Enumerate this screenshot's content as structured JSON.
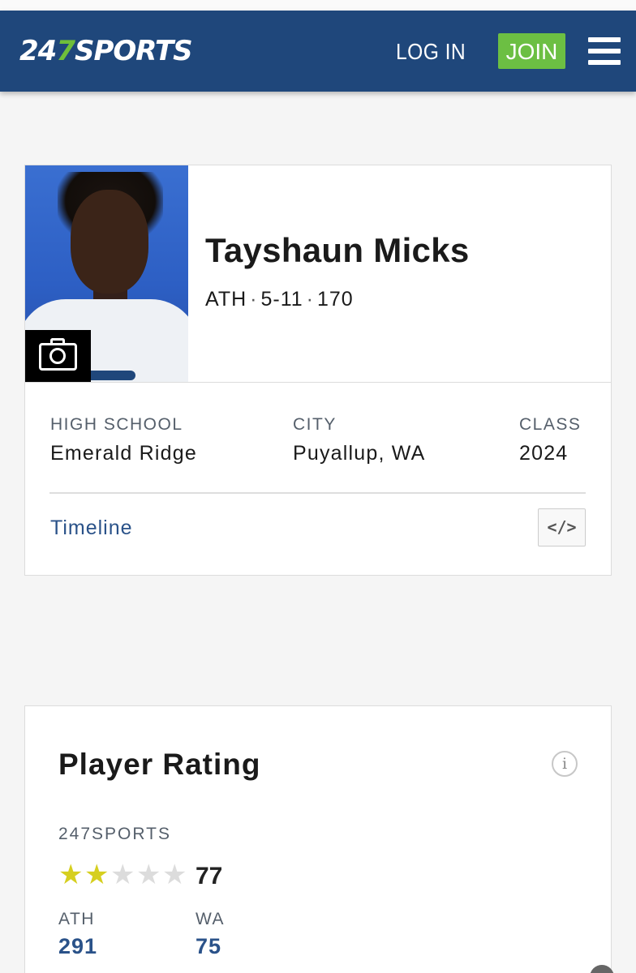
{
  "header": {
    "logo_prefix": "24",
    "logo_seven": "7",
    "logo_suffix": "SPORTS",
    "login_label": "LOG IN",
    "join_label": "JOIN",
    "menu_icon": "hamburger-menu-icon",
    "bg_color": "#1f477b",
    "join_color": "#6cbf43"
  },
  "player": {
    "name": "Tayshaun Micks",
    "position": "ATH",
    "height": "5-11",
    "weight": "170",
    "separator": "·",
    "photo_icon": "camera-icon"
  },
  "info": [
    {
      "label": "HIGH SCHOOL",
      "value": "Emerald Ridge"
    },
    {
      "label": "CITY",
      "value": "Puyallup, WA"
    },
    {
      "label": "CLASS",
      "value": "2024"
    }
  ],
  "links": {
    "timeline": "Timeline",
    "embed": "</>"
  },
  "rating": {
    "title": "Player Rating",
    "info_icon": "i",
    "source": "247SPORTS",
    "stars_filled": 2,
    "stars_total": 5,
    "star_filled_color": "#d6cf1f",
    "star_empty_color": "#dcdcdc",
    "score": "77",
    "ranks": [
      {
        "label": "ATH",
        "value": "291"
      },
      {
        "label": "WA",
        "value": "75"
      }
    ]
  }
}
